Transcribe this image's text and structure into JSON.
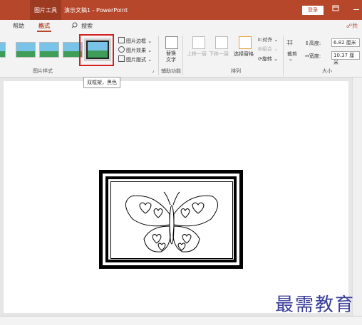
{
  "titlebar": {
    "tool_tab": "图片工具",
    "document_title": "演示文稿1 - PowerPoint",
    "login_label": "登录",
    "restore_icon": "restore-icon",
    "minimize_icon": "minimize-icon"
  },
  "tabs": {
    "help": "帮助",
    "format": "格式",
    "search": "搜索",
    "share": "共"
  },
  "ribbon": {
    "picture_styles": {
      "group_label": "图片样式",
      "commands": [
        "图片边框",
        "图片效果",
        "图片版式"
      ]
    },
    "accessibility": {
      "alt_text_line1": "替换",
      "alt_text_line2": "文字",
      "group_label": "辅助功能"
    },
    "arrange": {
      "bring_forward": "上移一层",
      "send_backward": "下移一层",
      "selection_pane": "选择窗格",
      "align": "对齐",
      "group": "组合",
      "rotate": "旋转",
      "group_label": "排列"
    },
    "size": {
      "crop": "裁剪",
      "height_label": "高度:",
      "height_value": "6.82 厘米",
      "width_label": "宽度:",
      "width_value": "10.37 厘米",
      "group_label": "大小"
    }
  },
  "tooltip": "双框架，黑色",
  "watermark": "最需教育"
}
